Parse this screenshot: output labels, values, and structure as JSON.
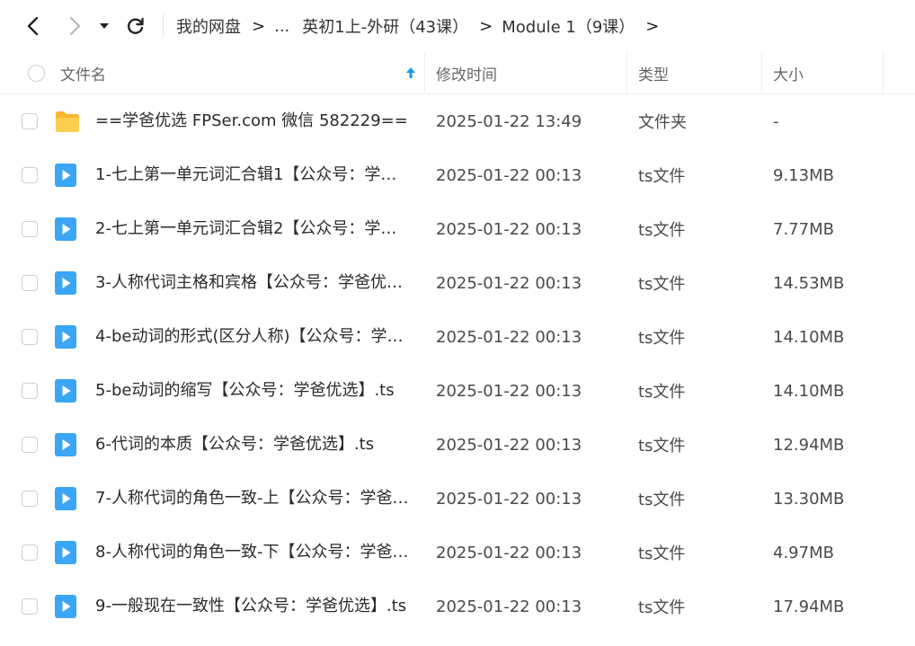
{
  "toolbar": {
    "icons": {
      "back": "chevron-left-icon",
      "forward": "chevron-right-icon",
      "history": "caret-down-icon",
      "refresh": "refresh-icon"
    }
  },
  "breadcrumb": {
    "items": [
      "我的网盘",
      "...",
      "英初1上-外研（43课）",
      "Module 1（9课）"
    ]
  },
  "header": {
    "name": "文件名",
    "modified": "修改时间",
    "type": "类型",
    "size": "大小",
    "sort_icon": "sort-arrow-up-icon"
  },
  "colors": {
    "accent": "#1e9bf0",
    "folder": "#f9c53d",
    "video": "#3aa6f5"
  },
  "files": [
    {
      "name": "==学爸优选 FPSer.com 微信 582229==",
      "time": "2025-01-22 13:49",
      "type": "文件夹",
      "size": "-",
      "icon": "folder-icon"
    },
    {
      "name": "1-七上第一单元词汇合辑1【公众号：学爸…",
      "time": "2025-01-22 00:13",
      "type": "ts文件",
      "size": "9.13MB",
      "icon": "video-file-icon"
    },
    {
      "name": "2-七上第一单元词汇合辑2【公众号：学爸…",
      "time": "2025-01-22 00:13",
      "type": "ts文件",
      "size": "7.77MB",
      "icon": "video-file-icon"
    },
    {
      "name": "3-人称代词主格和宾格【公众号：学爸优…",
      "time": "2025-01-22 00:13",
      "type": "ts文件",
      "size": "14.53MB",
      "icon": "video-file-icon"
    },
    {
      "name": "4-be动词的形式(区分人称)【公众号：学爸…",
      "time": "2025-01-22 00:13",
      "type": "ts文件",
      "size": "14.10MB",
      "icon": "video-file-icon"
    },
    {
      "name": "5-be动词的缩写【公众号：学爸优选】.ts",
      "time": "2025-01-22 00:13",
      "type": "ts文件",
      "size": "14.10MB",
      "icon": "video-file-icon"
    },
    {
      "name": "6-代词的本质【公众号：学爸优选】.ts",
      "time": "2025-01-22 00:13",
      "type": "ts文件",
      "size": "12.94MB",
      "icon": "video-file-icon"
    },
    {
      "name": "7-人称代词的角色一致-上【公众号：学爸…",
      "time": "2025-01-22 00:13",
      "type": "ts文件",
      "size": "13.30MB",
      "icon": "video-file-icon"
    },
    {
      "name": "8-人称代词的角色一致-下【公众号：学爸…",
      "time": "2025-01-22 00:13",
      "type": "ts文件",
      "size": "4.97MB",
      "icon": "video-file-icon"
    },
    {
      "name": "9-一般现在一致性【公众号：学爸优选】.ts",
      "time": "2025-01-22 00:13",
      "type": "ts文件",
      "size": "17.94MB",
      "icon": "video-file-icon"
    }
  ]
}
